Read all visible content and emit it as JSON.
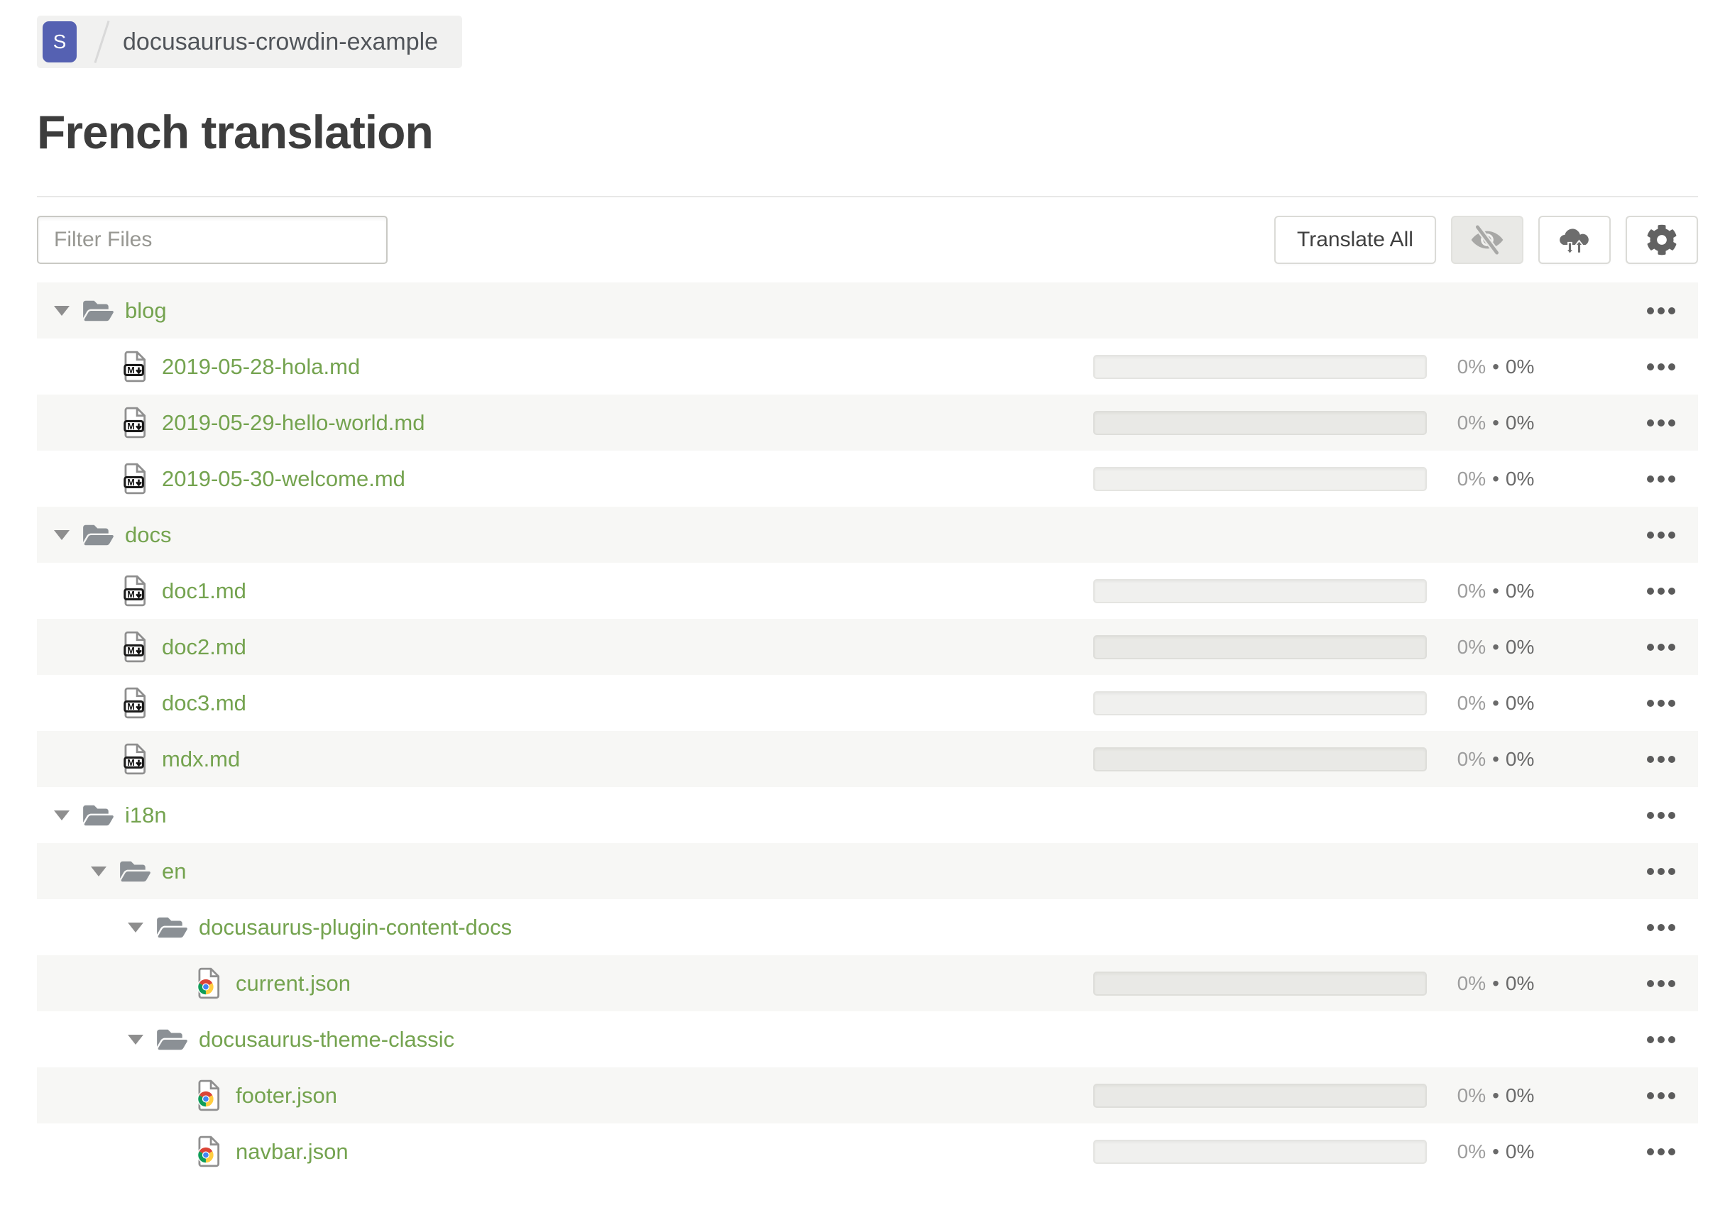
{
  "breadcrumb": {
    "workspace_initial": "S",
    "project_name": "docusaurus-crowdin-example"
  },
  "header": {
    "title": "French translation"
  },
  "toolbar": {
    "filter_placeholder": "Filter Files",
    "filter_value": "",
    "translate_all_label": "Translate All",
    "icon_buttons": [
      {
        "name": "visibility-toggle",
        "icon": "eye-off-icon",
        "pressed": true
      },
      {
        "name": "sync",
        "icon": "cloud-sync-icon",
        "pressed": false
      },
      {
        "name": "settings",
        "icon": "gear-icon",
        "pressed": false
      }
    ]
  },
  "progress_separator": "•",
  "tree": [
    {
      "kind": "folder",
      "label": "blog",
      "level": 0,
      "expanded": true
    },
    {
      "kind": "file",
      "filetype": "markdown",
      "label": "2019-05-28-hola.md",
      "level": 1,
      "translated": "0%",
      "approved": "0%"
    },
    {
      "kind": "file",
      "filetype": "markdown",
      "label": "2019-05-29-hello-world.md",
      "level": 1,
      "translated": "0%",
      "approved": "0%"
    },
    {
      "kind": "file",
      "filetype": "markdown",
      "label": "2019-05-30-welcome.md",
      "level": 1,
      "translated": "0%",
      "approved": "0%"
    },
    {
      "kind": "folder",
      "label": "docs",
      "level": 0,
      "expanded": true
    },
    {
      "kind": "file",
      "filetype": "markdown",
      "label": "doc1.md",
      "level": 1,
      "translated": "0%",
      "approved": "0%"
    },
    {
      "kind": "file",
      "filetype": "markdown",
      "label": "doc2.md",
      "level": 1,
      "translated": "0%",
      "approved": "0%"
    },
    {
      "kind": "file",
      "filetype": "markdown",
      "label": "doc3.md",
      "level": 1,
      "translated": "0%",
      "approved": "0%"
    },
    {
      "kind": "file",
      "filetype": "markdown",
      "label": "mdx.md",
      "level": 1,
      "translated": "0%",
      "approved": "0%"
    },
    {
      "kind": "folder",
      "label": "i18n",
      "level": 0,
      "expanded": true
    },
    {
      "kind": "folder",
      "label": "en",
      "level": 1,
      "expanded": true
    },
    {
      "kind": "folder",
      "label": "docusaurus-plugin-content-docs",
      "level": 2,
      "expanded": true
    },
    {
      "kind": "file",
      "filetype": "json",
      "label": "current.json",
      "level": 3,
      "translated": "0%",
      "approved": "0%"
    },
    {
      "kind": "folder",
      "label": "docusaurus-theme-classic",
      "level": 2,
      "expanded": true
    },
    {
      "kind": "file",
      "filetype": "json",
      "label": "footer.json",
      "level": 3,
      "translated": "0%",
      "approved": "0%"
    },
    {
      "kind": "file",
      "filetype": "json",
      "label": "navbar.json",
      "level": 3,
      "translated": "0%",
      "approved": "0%"
    }
  ],
  "colors": {
    "link_green": "#74a34f",
    "workspace_chip_indigo": "#5561b2",
    "row_alt_bg": "#f7f7f5",
    "folder_icon_gray": "#8b9095",
    "progress_track": "#f0f0ee",
    "percent_muted": "#9d9d9d",
    "percent_dark": "#6a6a6a"
  }
}
